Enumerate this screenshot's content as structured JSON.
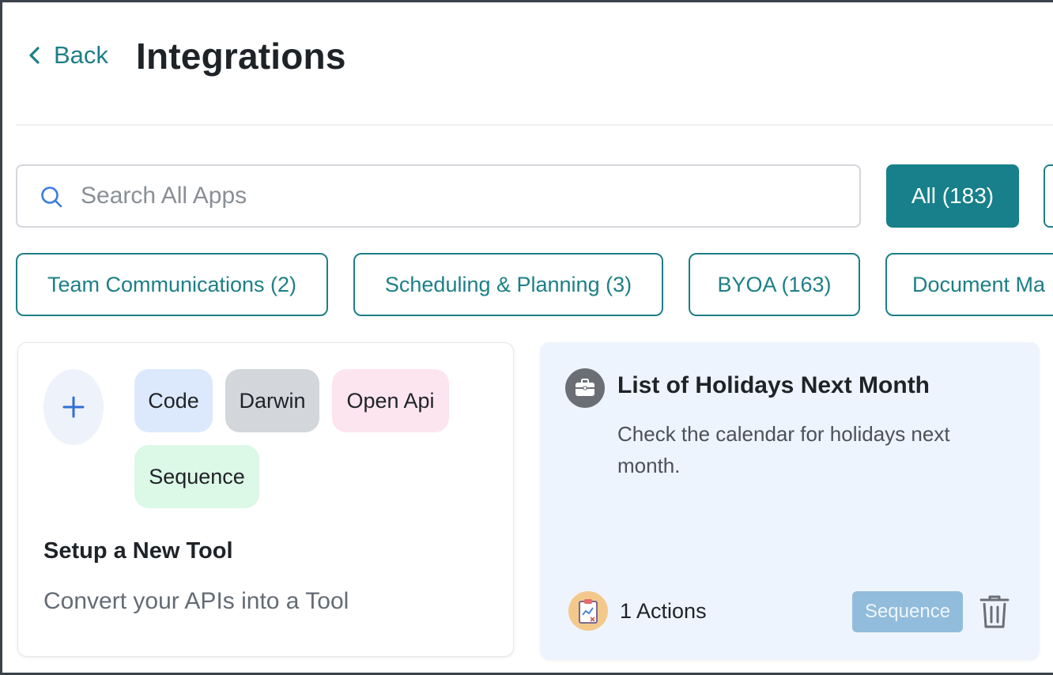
{
  "header": {
    "back_label": "Back",
    "title": "Integrations"
  },
  "search": {
    "placeholder": "Search All Apps",
    "value": ""
  },
  "filters": {
    "all_label": "All (183)",
    "categories": [
      {
        "label": "Team Communications (2)"
      },
      {
        "label": "Scheduling & Planning (3)"
      },
      {
        "label": "BYOA (163)"
      },
      {
        "label": "Document Ma"
      }
    ]
  },
  "new_tool_card": {
    "tags": [
      {
        "label": "Code",
        "color": "#dce9fd"
      },
      {
        "label": "Darwin",
        "color": "#d3d6db"
      },
      {
        "label": "Open Api",
        "color": "#fde5ef"
      },
      {
        "label": "Sequence",
        "color": "#dcf8e6"
      }
    ],
    "title": "Setup a New Tool",
    "subtitle": "Convert your APIs into a Tool"
  },
  "tool_card": {
    "icon": "briefcase-icon",
    "title": "List of Holidays Next Month",
    "description": "Check the calendar for holidays next month.",
    "actions_label": "1 Actions",
    "badge": "Sequence",
    "badge_color": "#92bcdb",
    "background": "#eef4fe"
  },
  "colors": {
    "accent": "#17808a",
    "accent_text": "#1d7f86"
  }
}
